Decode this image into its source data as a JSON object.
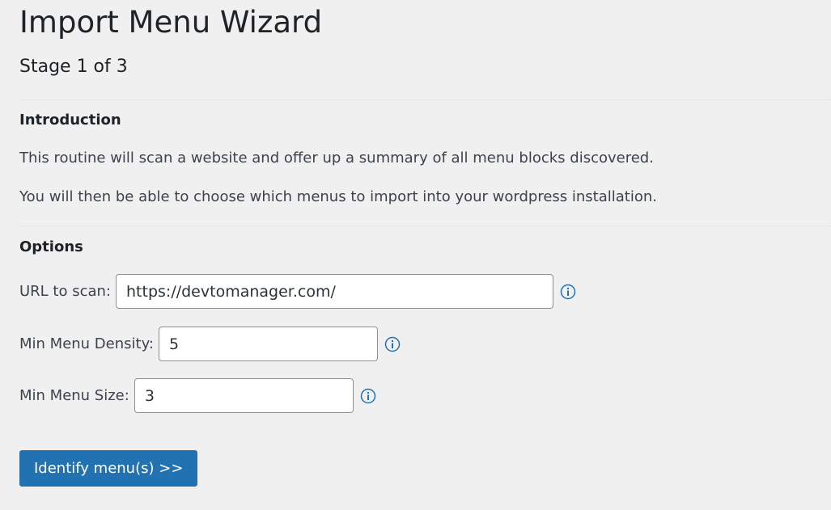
{
  "page": {
    "title": "Import Menu Wizard",
    "stage": "Stage 1 of 3"
  },
  "introduction": {
    "heading": "Introduction",
    "paragraphs": [
      "This routine will scan a website and offer up a summary of all menu blocks discovered.",
      "You will then be able to choose which menus to import into your wordpress installation."
    ]
  },
  "options": {
    "heading": "Options",
    "fields": [
      {
        "label": "URL to scan:",
        "value": "https://devtomanager.com/",
        "icon": "info-icon"
      },
      {
        "label": "Min Menu Density:",
        "value": "5",
        "icon": "info-icon"
      },
      {
        "label": "Min Menu Size:",
        "value": "3",
        "icon": "info-icon"
      }
    ]
  },
  "actions": {
    "submit_label": "Identify menu(s) >>"
  },
  "colors": {
    "background": "#f0f0f1",
    "accent": "#2271b1",
    "text": "#3c434a"
  }
}
